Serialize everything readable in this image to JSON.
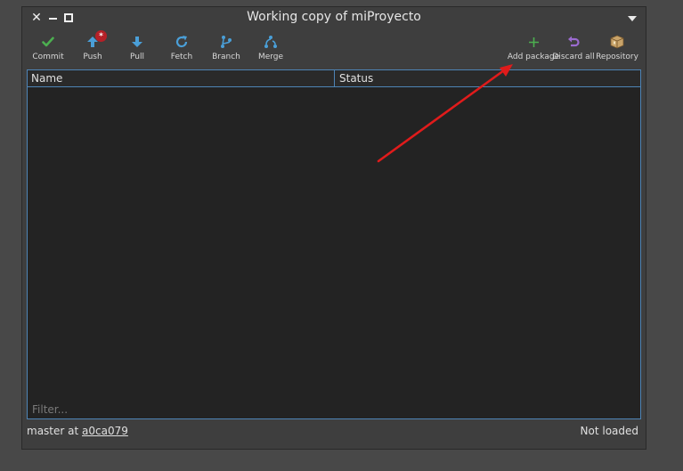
{
  "window": {
    "title": "Working copy of miProyecto"
  },
  "toolbar": {
    "items": [
      {
        "label": "Commit",
        "icon": "checkmark-icon",
        "color": "#4caf50"
      },
      {
        "label": "Push",
        "icon": "arrow-up-icon",
        "color": "#4a9fd8",
        "badge": "*"
      },
      {
        "label": "Pull",
        "icon": "arrow-down-icon",
        "color": "#4a9fd8"
      },
      {
        "label": "Fetch",
        "icon": "refresh-icon",
        "color": "#4a9fd8"
      },
      {
        "label": "Branch",
        "icon": "branch-icon",
        "color": "#4a9fd8"
      },
      {
        "label": "Merge",
        "icon": "merge-icon",
        "color": "#4a9fd8"
      },
      {
        "label": "Add package",
        "icon": "plus-icon",
        "color": "#4caf50"
      },
      {
        "label": "Discard all",
        "icon": "undo-icon",
        "color": "#9b6bd0"
      },
      {
        "label": "Repository",
        "icon": "package-box-icon",
        "color": "#c9a46a"
      }
    ]
  },
  "table": {
    "columns": [
      "Name",
      "Status"
    ],
    "rows": [],
    "filter_placeholder": "Filter..."
  },
  "status": {
    "branch_prefix": "master at ",
    "commit": "a0ca079",
    "state": "Not loaded"
  },
  "colors": {
    "accent_border": "#4e84b6",
    "annotation_arrow": "#e01b1b",
    "badge": "#b52027"
  }
}
